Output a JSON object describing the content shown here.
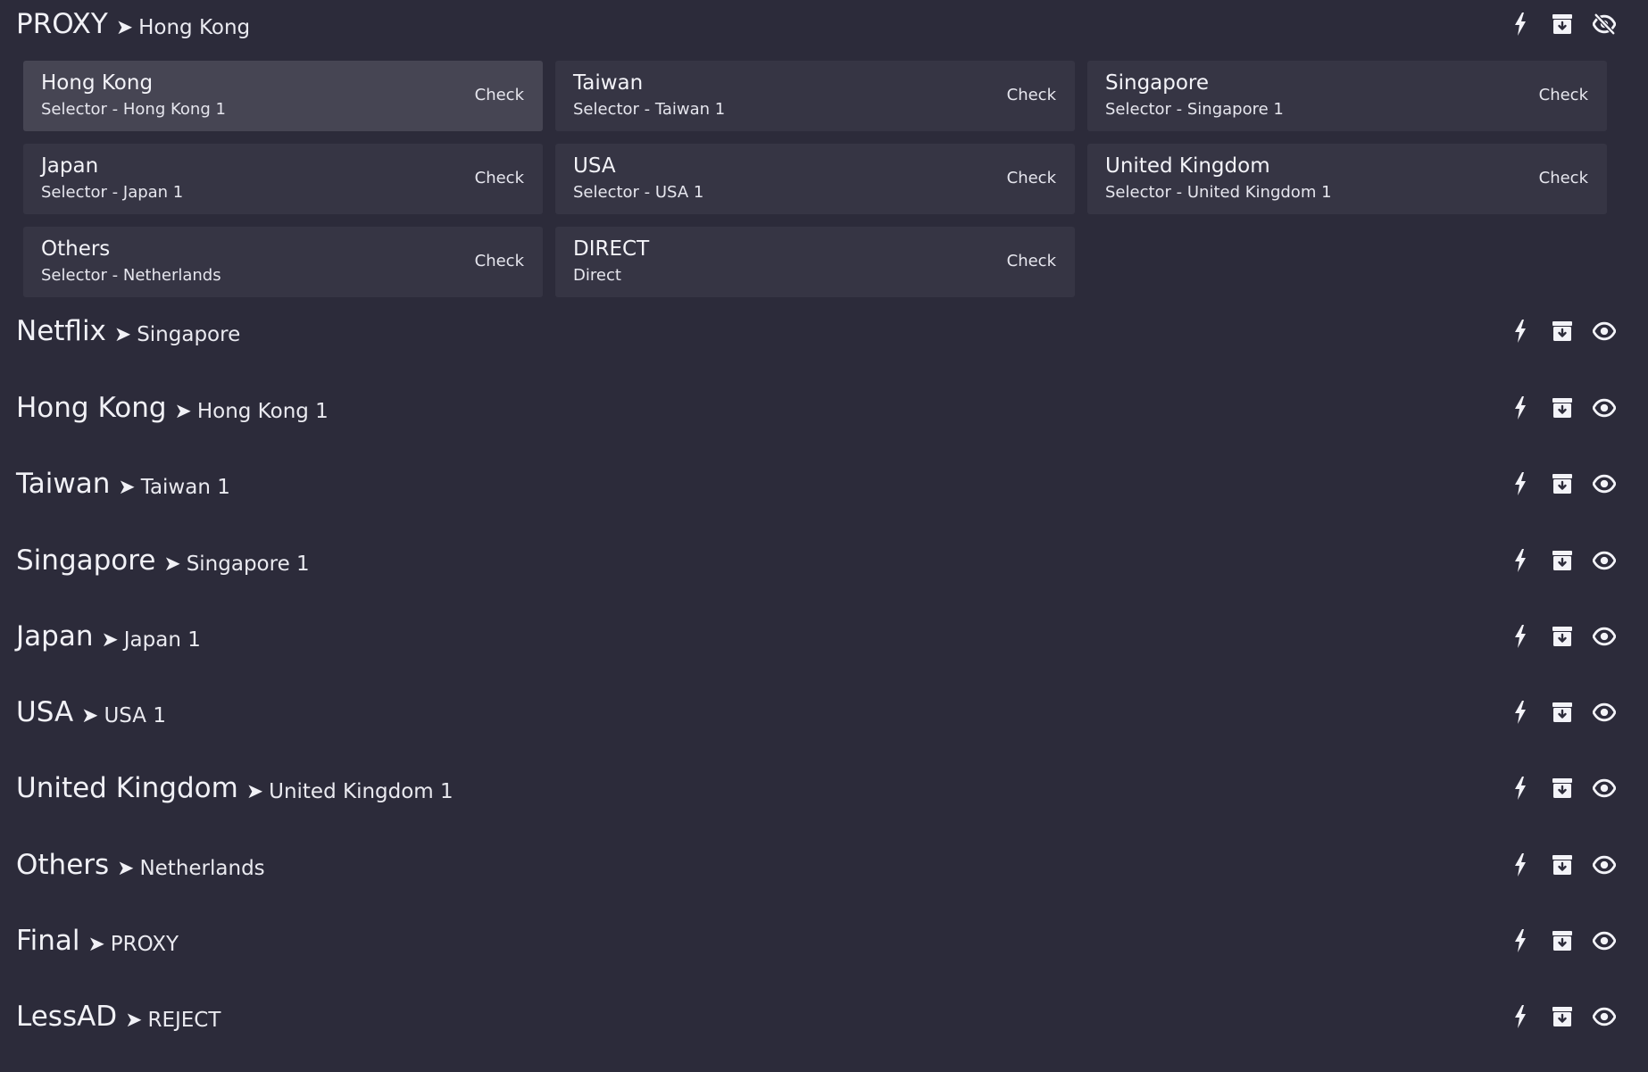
{
  "proxy_group": {
    "name": "PROXY",
    "now": "Hong Kong",
    "proxies": [
      {
        "name": "Hong Kong",
        "sub": "Selector - Hong Kong 1",
        "check": "Check"
      },
      {
        "name": "Taiwan",
        "sub": "Selector - Taiwan 1",
        "check": "Check"
      },
      {
        "name": "Singapore",
        "sub": "Selector - Singapore 1",
        "check": "Check"
      },
      {
        "name": "Japan",
        "sub": "Selector - Japan 1",
        "check": "Check"
      },
      {
        "name": "USA",
        "sub": "Selector - USA 1",
        "check": "Check"
      },
      {
        "name": "United Kingdom",
        "sub": "Selector - United Kingdom 1",
        "check": "Check"
      },
      {
        "name": "Others",
        "sub": "Selector - Netherlands",
        "check": "Check"
      },
      {
        "name": "DIRECT",
        "sub": "Direct",
        "check": "Check"
      }
    ]
  },
  "groups": [
    {
      "name": "Netflix",
      "now": "Singapore"
    },
    {
      "name": "Hong Kong",
      "now": "Hong Kong 1"
    },
    {
      "name": "Taiwan",
      "now": "Taiwan 1"
    },
    {
      "name": "Singapore",
      "now": "Singapore 1"
    },
    {
      "name": "Japan",
      "now": "Japan 1"
    },
    {
      "name": "USA",
      "now": "USA 1"
    },
    {
      "name": "United Kingdom",
      "now": "United Kingdom 1"
    },
    {
      "name": "Others",
      "now": "Netherlands"
    },
    {
      "name": "Final",
      "now": "PROXY"
    },
    {
      "name": "LessAD",
      "now": "REJECT"
    }
  ],
  "arrow": "➤",
  "icons": {
    "speedtest": "lightning-bolt-icon",
    "archive": "archive-box-icon",
    "hide": "eye-slash-icon",
    "show": "eye-icon"
  },
  "colors": {
    "background": "#2c2b3a",
    "card": "#363544",
    "card_active": "#464553",
    "text": "#ececf2"
  }
}
